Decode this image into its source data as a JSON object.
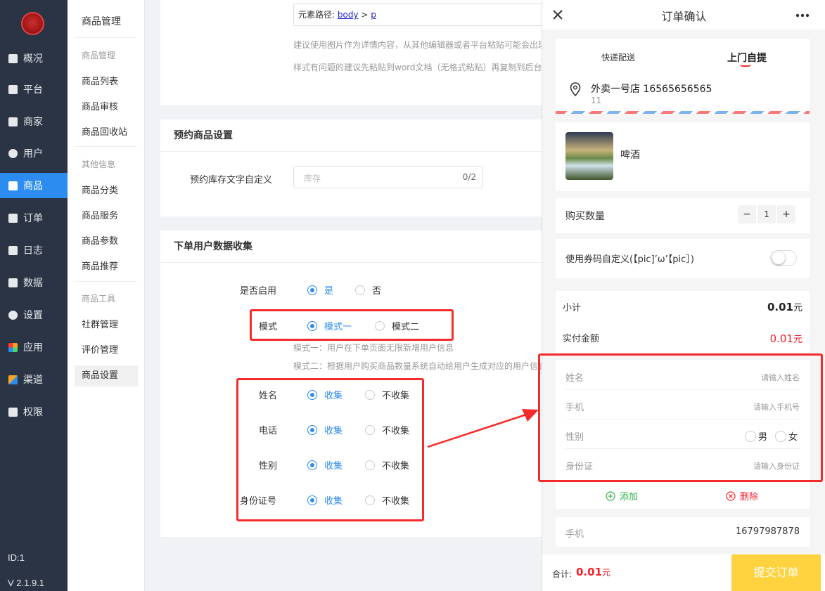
{
  "sidebar": {
    "items": [
      {
        "label": "概况",
        "icon": "chart-icon"
      },
      {
        "label": "平台",
        "icon": "monitor-icon"
      },
      {
        "label": "商家",
        "icon": "store-icon"
      },
      {
        "label": "用户",
        "icon": "user-icon"
      },
      {
        "label": "商品",
        "icon": "bag-icon"
      },
      {
        "label": "订单",
        "icon": "clipboard-icon"
      },
      {
        "label": "日志",
        "icon": "book-icon"
      },
      {
        "label": "数据",
        "icon": "bar-chart-icon"
      },
      {
        "label": "设置",
        "icon": "gear-icon"
      },
      {
        "label": "应用",
        "icon": "apps-icon"
      },
      {
        "label": "渠道",
        "icon": "cube-icon"
      },
      {
        "label": "权限",
        "icon": "lock-icon"
      }
    ],
    "id_text": "ID:1",
    "version": "V 2.1.9.1",
    "active_color": "#2d8cf0"
  },
  "submenu": {
    "title": "商品管理",
    "groups": [
      {
        "label": "商品管理",
        "items": [
          "商品列表",
          "商品审核",
          "商品回收站"
        ]
      },
      {
        "label": "其他信息",
        "items": [
          "商品分类",
          "商品服务",
          "商品参数",
          "商品推荐"
        ]
      },
      {
        "label": "商品工具",
        "items": [
          "社群管理",
          "评价管理",
          "商品设置"
        ]
      }
    ]
  },
  "editor": {
    "path_prefix": "元素路径: ",
    "path_body": "body",
    "path_sep": " > ",
    "path_p": "p",
    "tip1": "建议使用图片作为详情内容，从其他编辑器或者平台粘贴可能会出现",
    "tip2": "样式有问题的建议先粘贴到word文档（无格式粘贴）再复制到后台"
  },
  "reserve": {
    "title": "预约商品设置",
    "label": "预约库存文字自定义",
    "placeholder": "库存",
    "count": "0/2"
  },
  "collect": {
    "title": "下单用户数据收集",
    "enable_label": "是否启用",
    "yes": "是",
    "no": "否",
    "mode_label": "模式",
    "mode1": "模式一",
    "mode2": "模式二",
    "mode1_desc": "模式一：用户在下单页面无限新增用户信息",
    "mode2_desc": "模式二：根据用户购买商品数量系统自动给用户生成对应的用户信息",
    "fields": [
      {
        "label": "姓名",
        "on": "收集",
        "off": "不收集"
      },
      {
        "label": "电话",
        "on": "收集",
        "off": "不收集"
      },
      {
        "label": "性别",
        "on": "收集",
        "off": "不收集"
      },
      {
        "label": "身份证号",
        "on": "收集",
        "off": "不收集"
      }
    ]
  },
  "phone": {
    "title": "订单确认",
    "tab_express": "快递配送",
    "tab_pickup": "上门自提",
    "store": "外卖一号店 16565656565",
    "store_sub": "11",
    "product": "啤酒",
    "qty_label": "购买数量",
    "qty_minus": "−",
    "qty_value": "1",
    "qty_plus": "+",
    "coupon": "使用券码自定义(【pic]’ω’【pic］)",
    "subtotal_label": "小计",
    "subtotal": "0.01",
    "paid_label": "实付金额",
    "paid": "0.01",
    "unit": "元",
    "form": {
      "name": "姓名",
      "name_ph": "请输入姓名",
      "phone": "手机",
      "phone_ph": "请输入手机号",
      "gender": "性别",
      "male": "男",
      "female": "女",
      "idcard": "身份证",
      "idcard_ph": "请输入身份证"
    },
    "add": "添加",
    "delete": "删除",
    "mobile_label": "手机",
    "mobile": "16797987878",
    "total_label": "合计:",
    "total": "0.01",
    "submit": "提交订单",
    "price_color": "#f5222d",
    "submit_color": "#ffd340"
  }
}
